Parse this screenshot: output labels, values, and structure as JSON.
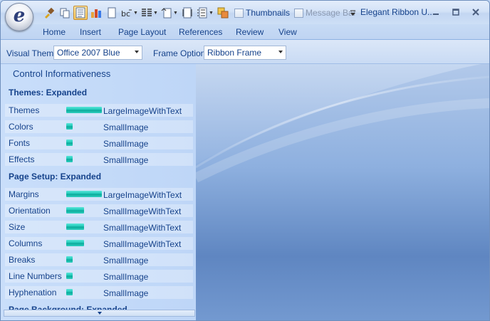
{
  "app": {
    "orb_letter": "e",
    "window_title": "Elegant Ribbon U...",
    "thumbnails_label": "Thumbnails",
    "message_bar_label": "Message Bar",
    "thumbnails_checked": false,
    "message_bar_checked": false
  },
  "tabs": [
    "Home",
    "Insert",
    "Page Layout",
    "References",
    "Review",
    "View"
  ],
  "options": {
    "visual_theme_label": "Visual Theme",
    "visual_theme_value": "Office 2007 Blue",
    "frame_options_label": "Frame Options",
    "frame_options_value": "Ribbon Frame"
  },
  "panel": {
    "title": "Control Informativeness",
    "sections": [
      {
        "title": "Themes: Expanded",
        "rows": [
          {
            "label": "Themes",
            "value": "LargeImageWithText",
            "level": "large"
          },
          {
            "label": "Colors",
            "value": "SmallImage",
            "level": "small"
          },
          {
            "label": "Fonts",
            "value": "SmallImage",
            "level": "small"
          },
          {
            "label": "Effects",
            "value": "SmallImage",
            "level": "small"
          }
        ]
      },
      {
        "title": "Page Setup: Expanded",
        "rows": [
          {
            "label": "Margins",
            "value": "LargeImageWithText",
            "level": "large"
          },
          {
            "label": "Orientation",
            "value": "SmallImageWithText",
            "level": "medium"
          },
          {
            "label": "Size",
            "value": "SmallImageWithText",
            "level": "medium"
          },
          {
            "label": "Columns",
            "value": "SmallImageWithText",
            "level": "medium"
          },
          {
            "label": "Breaks",
            "value": "SmallImage",
            "level": "small"
          },
          {
            "label": "Line Numbers",
            "value": "SmallImage",
            "level": "small"
          },
          {
            "label": "Hyphenation",
            "value": "SmallImage",
            "level": "small"
          }
        ]
      },
      {
        "title": "Page Background: Expanded",
        "rows": []
      }
    ]
  },
  "colors": {
    "text": "#15428b",
    "bar": "#1fc8b8"
  }
}
